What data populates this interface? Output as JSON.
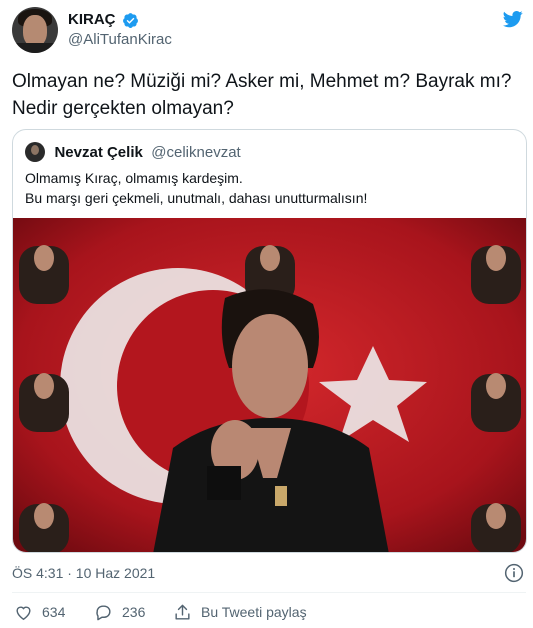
{
  "author": {
    "display_name": "KIRAÇ",
    "handle": "@AliTufanKirac",
    "verified": true,
    "avatar_icon": "profile-photo"
  },
  "tweet": {
    "text_line1": "Olmayan ne? Müziği mi? Asker mi, Mehmet m? Bayrak mı?",
    "text_line2": "Nedir gerçekten olmayan?"
  },
  "quoted": {
    "display_name": "Nevzat Çelik",
    "handle": "@celiknevzat",
    "text_line1": "Olmamış Kıraç, olmamış kardeşim.",
    "text_line2": "Bu marşı geri çekmeli, unutmalı, dahası unutturmalısın!",
    "media_icon": "video-thumbnail"
  },
  "meta": {
    "timestamp": "ÖS 4:31 · 10 Haz 2021"
  },
  "actions": {
    "likes": "634",
    "replies": "236",
    "share_label": "Bu Tweeti paylaş"
  },
  "colors": {
    "brand_blue": "#1d9bf0",
    "secondary_text": "#536471",
    "flag_red": "#c8102e"
  }
}
